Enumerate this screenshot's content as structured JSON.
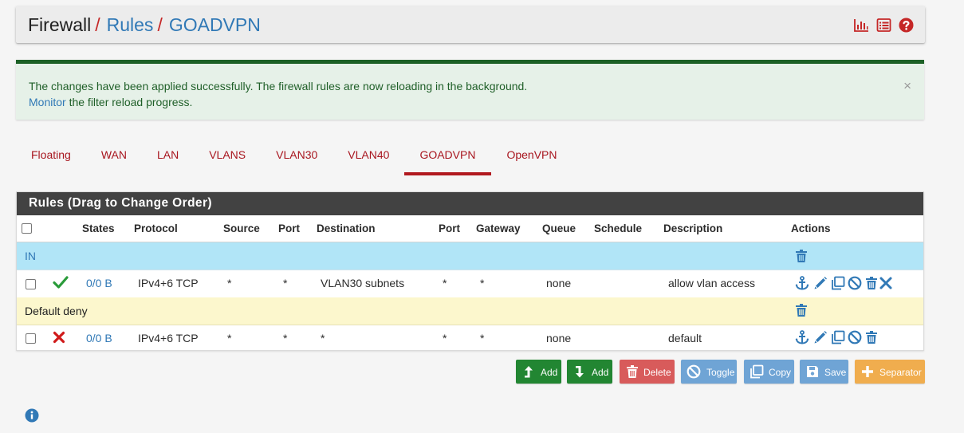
{
  "breadcrumb": {
    "first": "Firewall",
    "separator": "/",
    "second": "Rules",
    "third": "GOADVPN"
  },
  "header_icons": [
    "bar-chart-icon",
    "list-icon",
    "help-icon"
  ],
  "alert": {
    "message": "The changes have been applied successfully. The firewall rules are now reloading in the background.",
    "monitor_link": "Monitor",
    "monitor_suffix": " the filter reload progress.",
    "close": "×"
  },
  "tabs": [
    "Floating",
    "WAN",
    "LAN",
    "VLANS",
    "VLAN30",
    "VLAN40",
    "GOADVPN",
    "OpenVPN"
  ],
  "active_tab": "GOADVPN",
  "panel": {
    "title": "Rules (Drag to Change Order)",
    "columns": [
      "States",
      "Protocol",
      "Source",
      "Port",
      "Destination",
      "Port",
      "Gateway",
      "Queue",
      "Schedule",
      "Description",
      "Actions"
    ]
  },
  "separators": {
    "in": "IN",
    "default_deny": "Default deny"
  },
  "rules": [
    {
      "status": "pass",
      "states": "0/0 B",
      "protocol": "IPv4+6 TCP",
      "source": "*",
      "source_port": "*",
      "destination": "VLAN30 subnets",
      "dest_port": "*",
      "gateway": "*",
      "queue": "none",
      "schedule": "",
      "description": "allow vlan access"
    },
    {
      "status": "block",
      "states": "0/0 B",
      "protocol": "IPv4+6 TCP",
      "source": "*",
      "source_port": "*",
      "destination": "*",
      "dest_port": "*",
      "gateway": "*",
      "queue": "none",
      "schedule": "",
      "description": "default"
    }
  ],
  "buttons": {
    "add_top": "Add",
    "add_bottom": "Add",
    "delete": "Delete",
    "toggle": "Toggle",
    "copy": "Copy",
    "save": "Save",
    "separator": "Separator"
  },
  "colors": {
    "accent_red": "#b1191f",
    "link_blue": "#3179b6",
    "success_green": "#1c6126",
    "pass_green": "#2a9b3a",
    "block_red": "#d01b1b",
    "separator_in_bg": "#b1e5f7",
    "separator_default_bg": "#fcf7cd"
  }
}
